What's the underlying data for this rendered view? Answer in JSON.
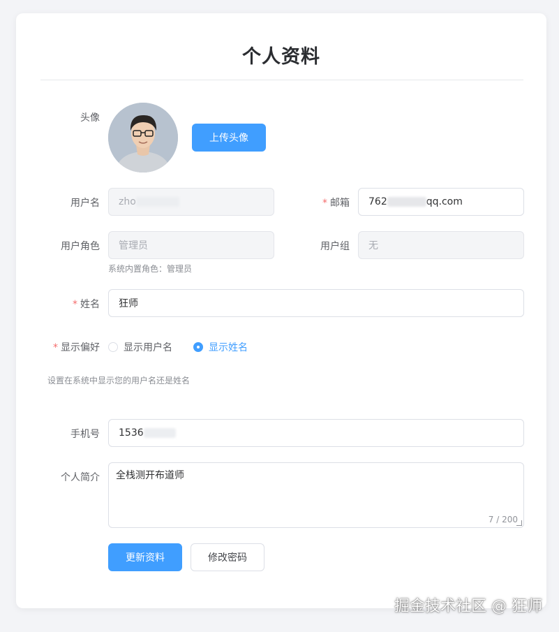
{
  "page": {
    "title": "个人资料"
  },
  "avatar": {
    "label": "头像",
    "upload_button": "上传头像"
  },
  "username": {
    "label": "用户名",
    "value": "zho"
  },
  "email": {
    "label": "邮箱",
    "required": "*",
    "value_prefix": "762",
    "value_suffix": "qq.com"
  },
  "role": {
    "label": "用户角色",
    "value": "管理员",
    "hint": "系统内置角色：管理员"
  },
  "group": {
    "label": "用户组",
    "value": "无"
  },
  "name": {
    "label": "姓名",
    "required": "*",
    "value": "狂师"
  },
  "display_pref": {
    "label": "显示偏好",
    "required": "*",
    "options": [
      {
        "label": "显示用户名",
        "checked": false
      },
      {
        "label": "显示姓名",
        "checked": true
      }
    ],
    "hint": "设置在系统中显示您的用户名还是姓名"
  },
  "phone": {
    "label": "手机号",
    "value": "1536"
  },
  "bio": {
    "label": "个人简介",
    "value": "全栈测开布道师",
    "counter": "7 / 200"
  },
  "actions": {
    "update": "更新资料",
    "change_password": "修改密码"
  },
  "watermark": "掘金技术社区 @ 狂师",
  "colors": {
    "primary": "#409eff",
    "required": "#f56c6c",
    "background": "#f3f4f7"
  }
}
